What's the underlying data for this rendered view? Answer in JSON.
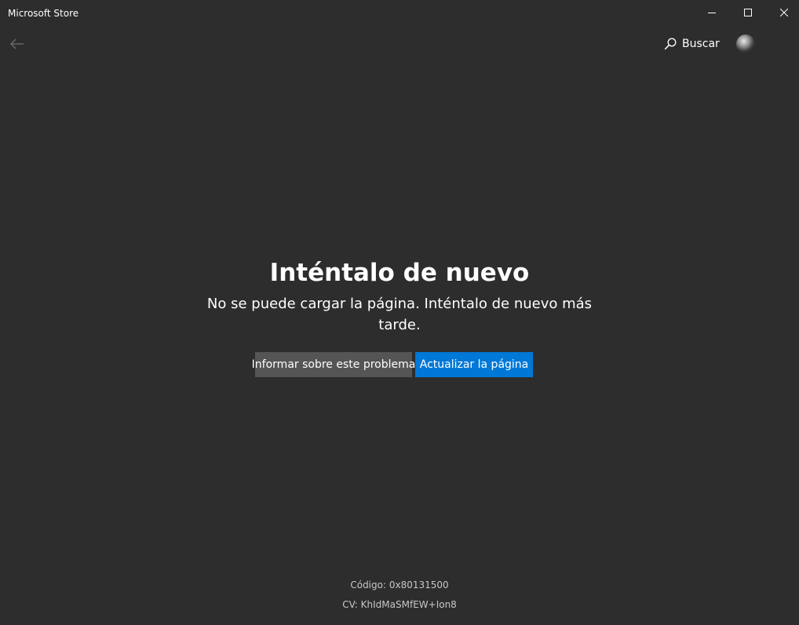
{
  "window": {
    "title": "Microsoft Store",
    "minimize_icon": "minimize-icon",
    "maximize_icon": "maximize-icon",
    "close_icon": "close-icon"
  },
  "nav": {
    "back_icon": "arrow-left-icon",
    "search_label": "Buscar",
    "search_icon": "search-icon",
    "avatar_icon": "avatar-icon"
  },
  "error": {
    "heading": "Inténtalo de nuevo",
    "message": "No se puede cargar la página. Inténtalo de nuevo más tarde.",
    "report_button": "Informar sobre este problema",
    "refresh_button": "Actualizar la página"
  },
  "footer": {
    "code": "Código: 0x80131500",
    "cv": "CV: KhIdMaSMfEW+Ion8"
  },
  "colors": {
    "background": "#2d2d2d",
    "accent": "#0078d7",
    "secondary_button": "#555555",
    "muted_text": "#c7c7c7"
  }
}
